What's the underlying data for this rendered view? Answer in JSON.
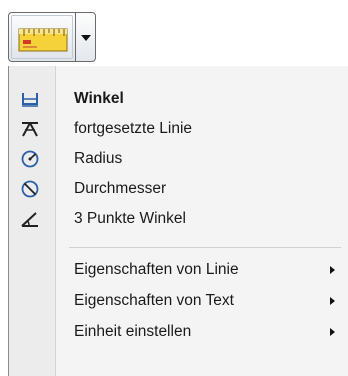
{
  "toolbar": {
    "measure_button_icon": "ruler-icon",
    "dropdown_icon": "chevron-down-icon"
  },
  "menu": {
    "items": [
      {
        "label": "Winkel",
        "icon": "angle-icon",
        "bold": true
      },
      {
        "label": "fortgesetzte Linie",
        "icon": "continued-line-icon"
      },
      {
        "label": "Radius",
        "icon": "radius-icon"
      },
      {
        "label": "Durchmesser",
        "icon": "diameter-icon"
      },
      {
        "label": "3 Punkte Winkel",
        "icon": "three-point-angle-icon"
      }
    ],
    "submenus": [
      {
        "label": "Eigenschaften von Linie",
        "icon": "submenu-arrow-icon"
      },
      {
        "label": "Eigenschaften von Text",
        "icon": "submenu-arrow-icon"
      },
      {
        "label": "Einheit einstellen",
        "icon": "submenu-arrow-icon"
      }
    ]
  },
  "colors": {
    "accent_blue": "#2b5fa8",
    "ruler_yellow": "#f5d13a",
    "ruler_red": "#d23a2a"
  }
}
